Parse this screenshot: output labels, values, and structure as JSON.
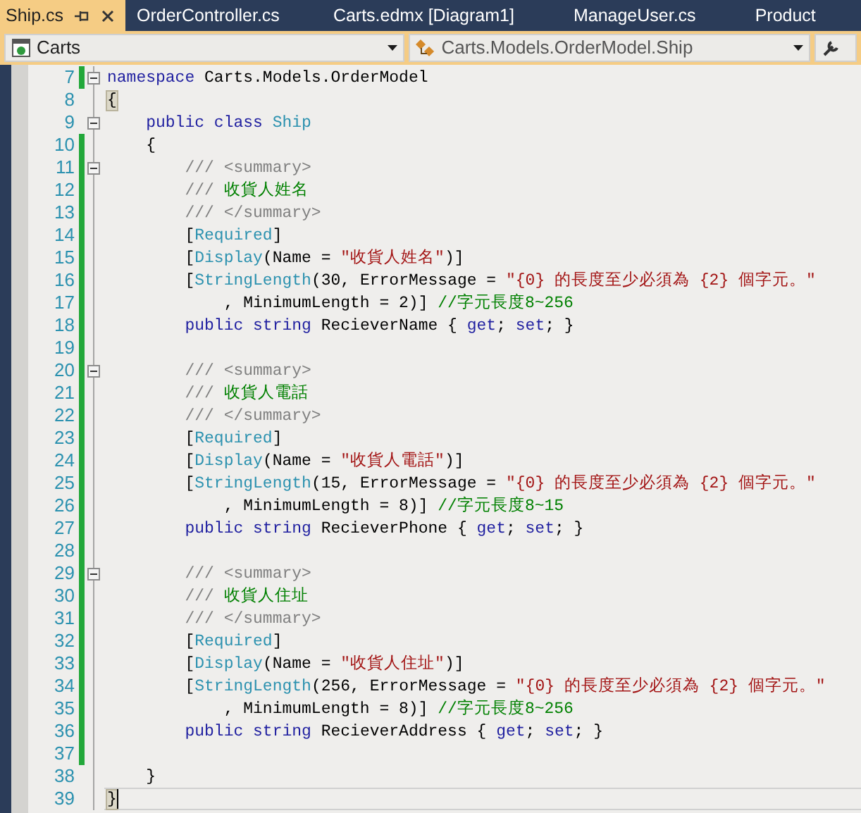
{
  "tabs": [
    {
      "label": "Ship.cs",
      "selected": true
    },
    {
      "label": "OrderController.cs",
      "selected": false
    },
    {
      "label": "Carts.edmx [Diagram1]",
      "selected": false
    },
    {
      "label": "ManageUser.cs",
      "selected": false
    },
    {
      "label": "Product",
      "selected": false
    }
  ],
  "navigation": {
    "project": "Carts",
    "type": "Carts.Models.OrderModel.Ship"
  },
  "lines": [
    {
      "number": "7",
      "changed": true,
      "foldable": true,
      "current": false,
      "tokens": [
        {
          "kind": "keyword",
          "text": "namespace"
        },
        {
          "kind": "plain",
          "text": " Carts.Models.OrderModel"
        }
      ]
    },
    {
      "number": "8",
      "changed": false,
      "foldable": false,
      "current": false,
      "tokens": [
        {
          "kind": "brace",
          "text": "{"
        }
      ]
    },
    {
      "number": "9",
      "changed": false,
      "foldable": true,
      "current": false,
      "tokens": [
        {
          "kind": "keyword",
          "text": "    public"
        },
        {
          "kind": "keyword",
          "text": " class"
        },
        {
          "kind": "type",
          "text": " Ship"
        }
      ]
    },
    {
      "number": "10",
      "changed": true,
      "foldable": false,
      "current": false,
      "tokens": [
        {
          "kind": "plain",
          "text": "    {"
        }
      ]
    },
    {
      "number": "11",
      "changed": true,
      "foldable": true,
      "current": false,
      "tokens": [
        {
          "kind": "doc",
          "text": "        /// <summary>"
        }
      ]
    },
    {
      "number": "12",
      "changed": true,
      "foldable": false,
      "current": false,
      "tokens": [
        {
          "kind": "doc",
          "text": "        ///"
        },
        {
          "kind": "comment",
          "text": " 收貨人姓名"
        }
      ]
    },
    {
      "number": "13",
      "changed": true,
      "foldable": false,
      "current": false,
      "tokens": [
        {
          "kind": "doc",
          "text": "        /// </summary>"
        }
      ]
    },
    {
      "number": "14",
      "changed": true,
      "foldable": false,
      "current": false,
      "tokens": [
        {
          "kind": "plain",
          "text": "        ["
        },
        {
          "kind": "type",
          "text": "Required"
        },
        {
          "kind": "plain",
          "text": "]"
        }
      ]
    },
    {
      "number": "15",
      "changed": true,
      "foldable": false,
      "current": false,
      "tokens": [
        {
          "kind": "plain",
          "text": "        ["
        },
        {
          "kind": "type",
          "text": "Display"
        },
        {
          "kind": "plain",
          "text": "(Name = "
        },
        {
          "kind": "string",
          "text": "\"收貨人姓名\""
        },
        {
          "kind": "plain",
          "text": ")]"
        }
      ]
    },
    {
      "number": "16",
      "changed": true,
      "foldable": false,
      "current": false,
      "tokens": [
        {
          "kind": "plain",
          "text": "        ["
        },
        {
          "kind": "type",
          "text": "StringLength"
        },
        {
          "kind": "plain",
          "text": "(30, ErrorMessage = "
        },
        {
          "kind": "string",
          "text": "\"{0} 的長度至少必須為 {2} 個字元。\""
        }
      ]
    },
    {
      "number": "17",
      "changed": true,
      "foldable": false,
      "current": false,
      "tokens": [
        {
          "kind": "plain",
          "text": "            , MinimumLength = 2)]"
        },
        {
          "kind": "comment",
          "text": " //字元長度8~256"
        }
      ]
    },
    {
      "number": "18",
      "changed": true,
      "foldable": false,
      "current": false,
      "tokens": [
        {
          "kind": "keyword",
          "text": "        public"
        },
        {
          "kind": "keyword",
          "text": " string"
        },
        {
          "kind": "plain",
          "text": " RecieverName {"
        },
        {
          "kind": "keyword",
          "text": " get"
        },
        {
          "kind": "plain",
          "text": ";"
        },
        {
          "kind": "keyword",
          "text": " set"
        },
        {
          "kind": "plain",
          "text": "; }"
        }
      ]
    },
    {
      "number": "19",
      "changed": true,
      "foldable": false,
      "current": false
    },
    {
      "number": "20",
      "changed": true,
      "foldable": true,
      "current": false,
      "tokens": [
        {
          "kind": "doc",
          "text": "        /// <summary>"
        }
      ]
    },
    {
      "number": "21",
      "changed": true,
      "foldable": false,
      "current": false,
      "tokens": [
        {
          "kind": "doc",
          "text": "        ///"
        },
        {
          "kind": "comment",
          "text": " 收貨人電話"
        }
      ]
    },
    {
      "number": "22",
      "changed": true,
      "foldable": false,
      "current": false,
      "tokens": [
        {
          "kind": "doc",
          "text": "        /// </summary>"
        }
      ]
    },
    {
      "number": "23",
      "changed": true,
      "foldable": false,
      "current": false,
      "tokens": [
        {
          "kind": "plain",
          "text": "        ["
        },
        {
          "kind": "type",
          "text": "Required"
        },
        {
          "kind": "plain",
          "text": "]"
        }
      ]
    },
    {
      "number": "24",
      "changed": true,
      "foldable": false,
      "current": false,
      "tokens": [
        {
          "kind": "plain",
          "text": "        ["
        },
        {
          "kind": "type",
          "text": "Display"
        },
        {
          "kind": "plain",
          "text": "(Name = "
        },
        {
          "kind": "string",
          "text": "\"收貨人電話\""
        },
        {
          "kind": "plain",
          "text": ")]"
        }
      ]
    },
    {
      "number": "25",
      "changed": true,
      "foldable": false,
      "current": false,
      "tokens": [
        {
          "kind": "plain",
          "text": "        ["
        },
        {
          "kind": "type",
          "text": "StringLength"
        },
        {
          "kind": "plain",
          "text": "(15, ErrorMessage = "
        },
        {
          "kind": "string",
          "text": "\"{0} 的長度至少必須為 {2} 個字元。\""
        }
      ]
    },
    {
      "number": "26",
      "changed": true,
      "foldable": false,
      "current": false,
      "tokens": [
        {
          "kind": "plain",
          "text": "            , MinimumLength = 8)]"
        },
        {
          "kind": "comment",
          "text": " //字元長度8~15"
        }
      ]
    },
    {
      "number": "27",
      "changed": true,
      "foldable": false,
      "current": false,
      "tokens": [
        {
          "kind": "keyword",
          "text": "        public"
        },
        {
          "kind": "keyword",
          "text": " string"
        },
        {
          "kind": "plain",
          "text": " RecieverPhone {"
        },
        {
          "kind": "keyword",
          "text": " get"
        },
        {
          "kind": "plain",
          "text": ";"
        },
        {
          "kind": "keyword",
          "text": " set"
        },
        {
          "kind": "plain",
          "text": "; }"
        }
      ]
    },
    {
      "number": "28",
      "changed": true,
      "foldable": false,
      "current": false
    },
    {
      "number": "29",
      "changed": true,
      "foldable": true,
      "current": false,
      "tokens": [
        {
          "kind": "doc",
          "text": "        /// <summary>"
        }
      ]
    },
    {
      "number": "30",
      "changed": true,
      "foldable": false,
      "current": false,
      "tokens": [
        {
          "kind": "doc",
          "text": "        ///"
        },
        {
          "kind": "comment",
          "text": " 收貨人住址"
        }
      ]
    },
    {
      "number": "31",
      "changed": true,
      "foldable": false,
      "current": false,
      "tokens": [
        {
          "kind": "doc",
          "text": "        /// </summary>"
        }
      ]
    },
    {
      "number": "32",
      "changed": true,
      "foldable": false,
      "current": false,
      "tokens": [
        {
          "kind": "plain",
          "text": "        ["
        },
        {
          "kind": "type",
          "text": "Required"
        },
        {
          "kind": "plain",
          "text": "]"
        }
      ]
    },
    {
      "number": "33",
      "changed": true,
      "foldable": false,
      "current": false,
      "tokens": [
        {
          "kind": "plain",
          "text": "        ["
        },
        {
          "kind": "type",
          "text": "Display"
        },
        {
          "kind": "plain",
          "text": "(Name = "
        },
        {
          "kind": "string",
          "text": "\"收貨人住址\""
        },
        {
          "kind": "plain",
          "text": ")]"
        }
      ]
    },
    {
      "number": "34",
      "changed": true,
      "foldable": false,
      "current": false,
      "tokens": [
        {
          "kind": "plain",
          "text": "        ["
        },
        {
          "kind": "type",
          "text": "StringLength"
        },
        {
          "kind": "plain",
          "text": "(256, ErrorMessage = "
        },
        {
          "kind": "string",
          "text": "\"{0} 的長度至少必須為 {2} 個字元。\""
        }
      ]
    },
    {
      "number": "35",
      "changed": true,
      "foldable": false,
      "current": false,
      "tokens": [
        {
          "kind": "plain",
          "text": "            , MinimumLength = 8)]"
        },
        {
          "kind": "comment",
          "text": " //字元長度8~256"
        }
      ]
    },
    {
      "number": "36",
      "changed": true,
      "foldable": false,
      "current": false,
      "tokens": [
        {
          "kind": "keyword",
          "text": "        public"
        },
        {
          "kind": "keyword",
          "text": " string"
        },
        {
          "kind": "plain",
          "text": " RecieverAddress {"
        },
        {
          "kind": "keyword",
          "text": " get"
        },
        {
          "kind": "plain",
          "text": ";"
        },
        {
          "kind": "keyword",
          "text": " set"
        },
        {
          "kind": "plain",
          "text": "; }"
        }
      ]
    },
    {
      "number": "37",
      "changed": true,
      "foldable": false,
      "current": false
    },
    {
      "number": "38",
      "changed": false,
      "foldable": false,
      "current": false,
      "tokens": [
        {
          "kind": "plain",
          "text": "    }"
        }
      ]
    },
    {
      "number": "39",
      "changed": false,
      "foldable": false,
      "current": true,
      "tokens": [
        {
          "kind": "brace",
          "text": "}"
        }
      ]
    }
  ]
}
